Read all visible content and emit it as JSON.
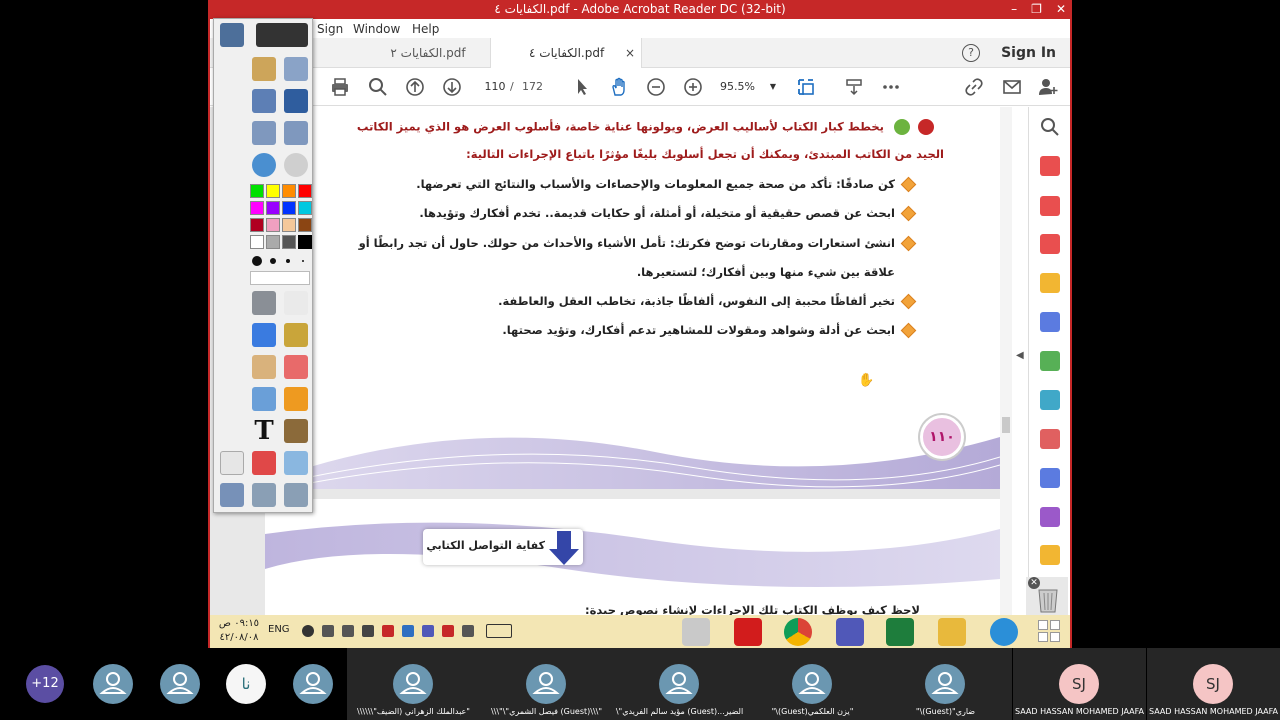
{
  "window": {
    "title": "الكفايات ٤.pdf - Adobe Acrobat Reader DC (32-bit)",
    "controls": [
      "–",
      "❐",
      "✕"
    ]
  },
  "menu": [
    "Sign",
    "Window",
    "Help"
  ],
  "tabs": [
    {
      "label": "الكفايات ٢.pdf",
      "active": false
    },
    {
      "label": "الكفايات ٤.pdf",
      "active": true,
      "close": "×"
    }
  ],
  "header": {
    "help": "?",
    "signin": "Sign In"
  },
  "toolbar": {
    "page_current": "110",
    "page_sep": "/",
    "page_total": "172",
    "zoom": "95.5%"
  },
  "document": {
    "intro_line1": "يخطط كبار الكتاب لأساليب العرض، ويولونها عناية خاصة، فأسلوب العرض هو الذي يميز الكاتب",
    "intro_line2": "الجيد من الكاتب المبتدئ، ويمكنك أن تجعل أسلوبك بليغًا مؤثرًا باتباع الإجراءات التالية:",
    "bullets": [
      "كن صادقًا: تأكد من صحة جميع المعلومات والإحصاءات والأسباب والنتائج التي تعرضها.",
      "ابحث عن قصص حقيقية أو متخيلة، أو أمثلة، أو حكايات قديمة.. تخدم أفكارك وتؤيدها.",
      "انشئ استعارات ومقارنات توضح فكرتك: تأمل الأشياء والأحداث من حولك. حاول أن تجد رابطًا أو",
      "علاقة بين شيء منها وبين أفكارك؛ لتستعيرها.",
      "تخير ألفاظًا محببة إلى النفوس، ألفاظًا جاذبة، تخاطب العقل والعاطفة.",
      "ابحث عن أدلة وشواهد ومقولات للمشاهير تدعم أفكارك، وتؤيد صحتها."
    ],
    "page_number": "١١٠",
    "section_banner": "كفاية التواصل الكتابي",
    "next_line": "لاحظ كيف يوظف الكتاب تلك الإجراءات لإنشاء نصوص جيدة:"
  },
  "taskbar": {
    "time": "٠٩:١٥ ص",
    "date": "٤٢/٠٨/٠٨",
    "lang": "ENG"
  },
  "participants": [
    {
      "initials": "+12",
      "name": ""
    },
    {
      "initials": "",
      "name": ""
    },
    {
      "initials": "",
      "name": ""
    },
    {
      "initials": "نا",
      "name": ""
    },
    {
      "initials": "",
      "name": ""
    },
    {
      "initials": "",
      "name": "\\\\\\\\\\\\\"عبدالملك الزهراني (الضيف\""
    },
    {
      "initials": "",
      "name": "\\\\\\\"\\\"فيصل الشمري (Guest)\\\\\\\""
    },
    {
      "initials": "",
      "name": "\\\"مؤيد سالم الفريدي (Guest)...الضير"
    },
    {
      "initials": "",
      "name": "\"\\(Guest)يزن العلكمي\""
    },
    {
      "initials": "",
      "name": "\"\\(Guest)\"ضاري"
    },
    {
      "initials": "SJ",
      "name": "SAAD HASSAN MOHAMED JAAFAR"
    },
    {
      "initials": "SJ",
      "name": "SAAD HASSAN MOHAMED JAAFAR"
    }
  ],
  "colors": {
    "titlebar": "#c62828",
    "taskbar": "#f3e6b4",
    "avatar_blue": "#6b97b1",
    "avatar_pink": "#f5c5c5",
    "bullet": "#f2a33a"
  }
}
